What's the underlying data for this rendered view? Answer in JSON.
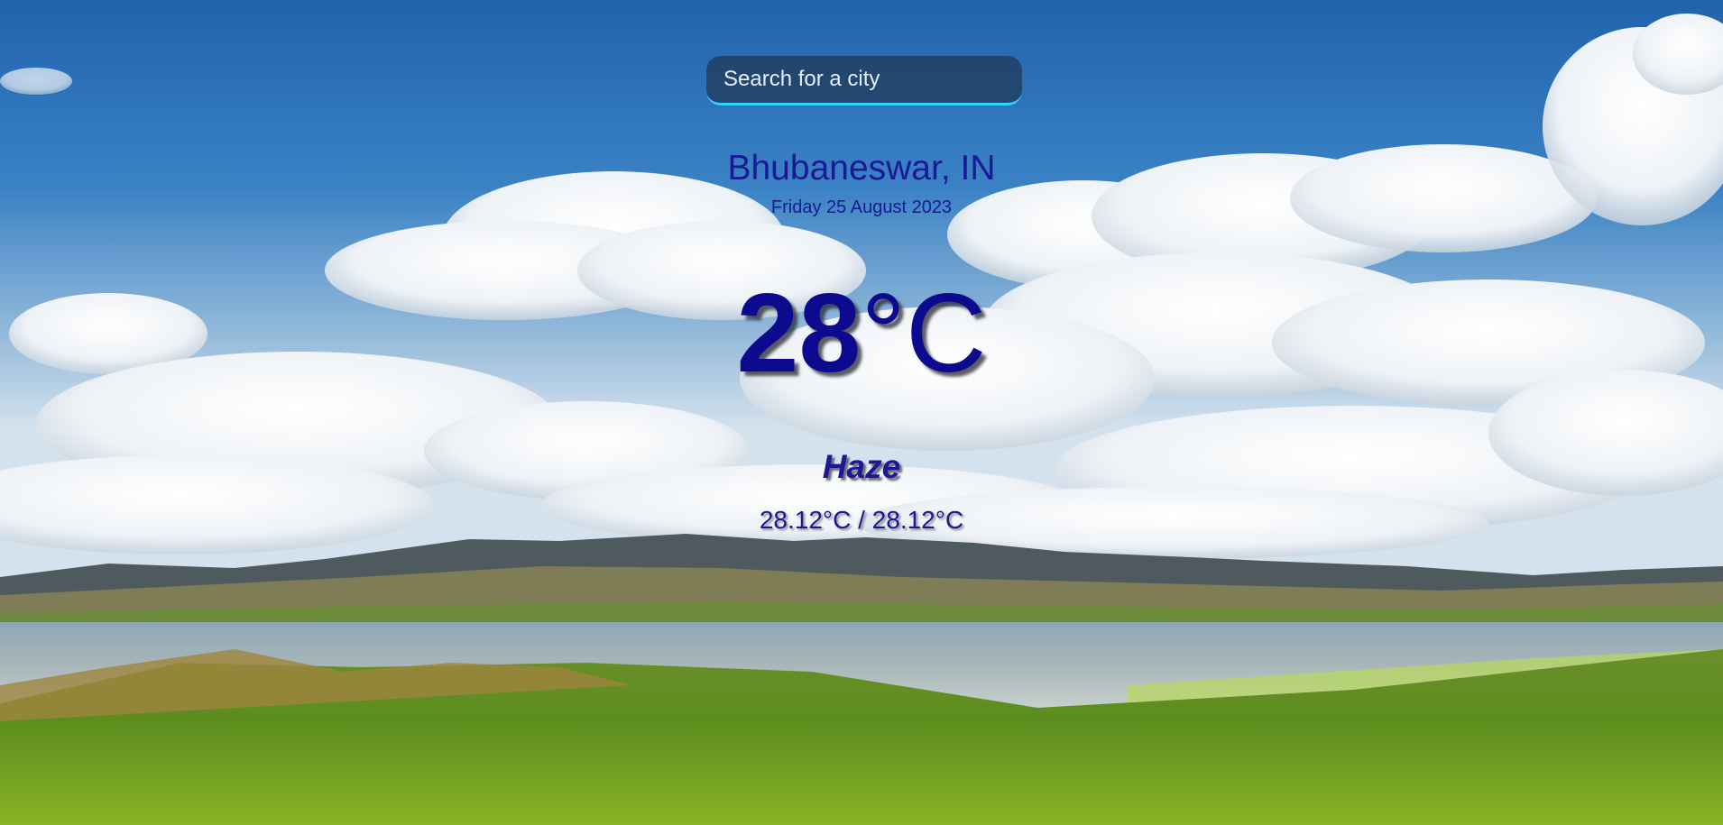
{
  "search": {
    "placeholder": "Search for a city"
  },
  "weather": {
    "location": "Bhubaneswar, IN",
    "date": "Friday 25 August 2023",
    "temperature": "28",
    "unit": "°C",
    "condition": "Haze",
    "min_max": "28.12°C / 28.12°C"
  },
  "colors": {
    "text": "#1a1896",
    "search_underline": "#2fd3ff"
  }
}
